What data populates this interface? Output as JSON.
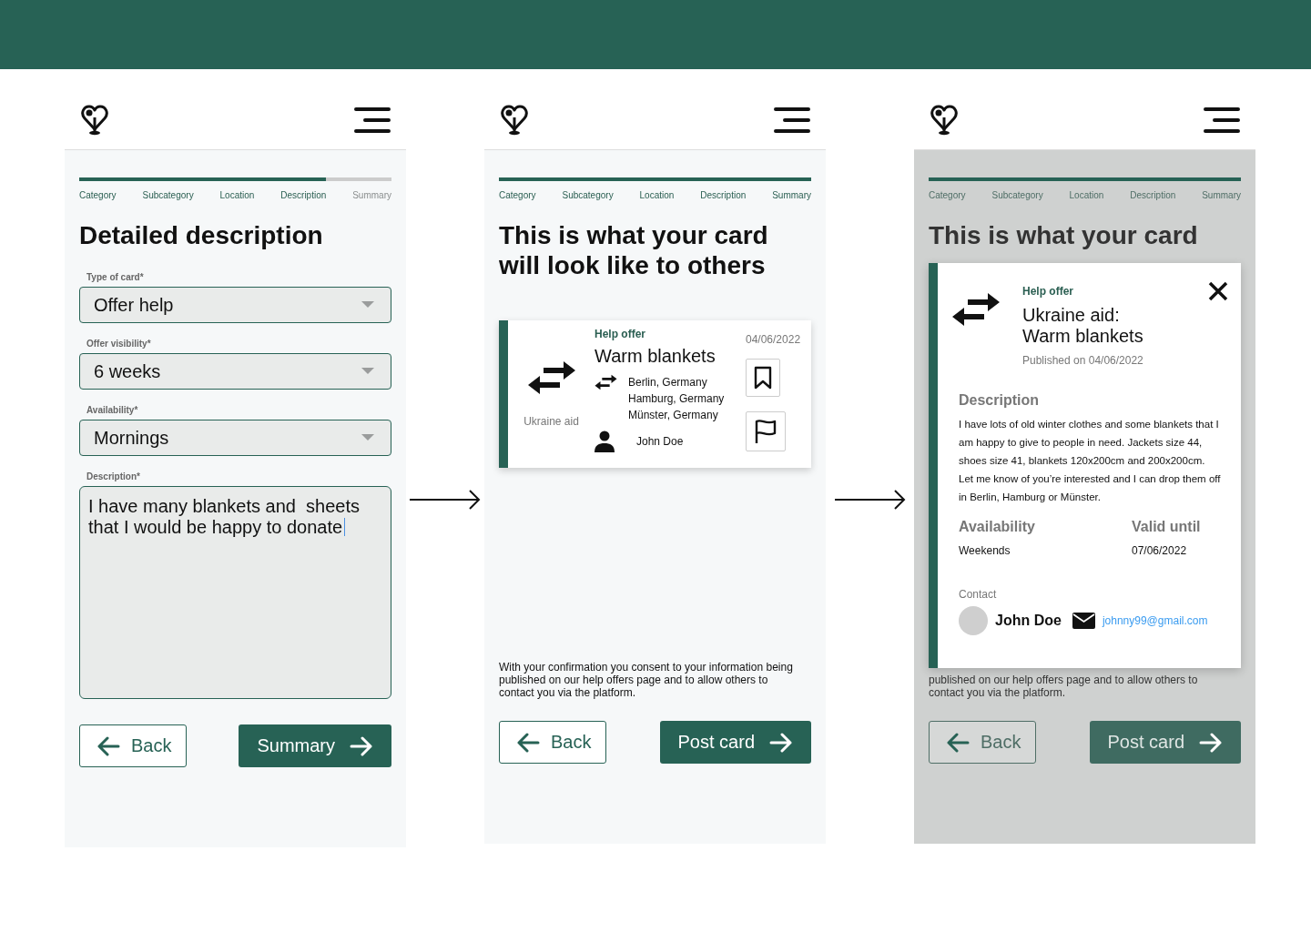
{
  "screens": [
    {
      "kind": "form",
      "progress": {
        "level": 0.79,
        "steps": [
          {
            "label": "Category",
            "reached": true
          },
          {
            "label": "Subcategory",
            "reached": true
          },
          {
            "label": "Location",
            "reached": true
          },
          {
            "label": "Description",
            "reached": true
          },
          {
            "label": "Summary",
            "reached": false
          }
        ]
      },
      "title": "Detailed description",
      "fields": [
        {
          "kind": "select",
          "label": "Type of card*",
          "value": "Offer help"
        },
        {
          "kind": "select",
          "label": "Offer visibility*",
          "value": "6 weeks"
        },
        {
          "kind": "select",
          "label": "Availability*",
          "value": "Mornings"
        },
        {
          "kind": "textarea",
          "label": "Description*",
          "value": "I have many blankets and  sheets that I would be happy to donate",
          "focused": true
        }
      ],
      "buttons": [
        {
          "kind": "back",
          "label": "Back"
        },
        {
          "kind": "next",
          "label": "Summary"
        }
      ]
    },
    {
      "kind": "preview",
      "dimmed": false,
      "progress": {
        "level": 1,
        "steps": [
          {
            "label": "Category",
            "reached": true
          },
          {
            "label": "Subcategory",
            "reached": true
          },
          {
            "label": "Location",
            "reached": true
          },
          {
            "label": "Description",
            "reached": true
          },
          {
            "label": "Summary",
            "reached": true
          }
        ]
      },
      "title": "This is what your card will look like to others",
      "card": {
        "category": "Ukraine aid",
        "type": "Help offer",
        "title": "Warm blankets",
        "date": "04/06/2022",
        "locations": [
          "Berlin, Germany",
          "Hamburg, Germany",
          "Münster, Germany"
        ],
        "author": "John Doe"
      },
      "consent": "With your confirmation you consent to your information being published on our help offers page and to allow others to contact you via the platform.",
      "buttons": [
        {
          "kind": "back",
          "label": "Back"
        },
        {
          "kind": "next",
          "label": "Post card"
        }
      ]
    },
    {
      "kind": "preview",
      "dimmed": true,
      "progress": {
        "level": 1,
        "steps": [
          {
            "label": "Category",
            "reached": true
          },
          {
            "label": "Subcategory",
            "reached": true
          },
          {
            "label": "Location",
            "reached": true
          },
          {
            "label": "Description",
            "reached": true
          },
          {
            "label": "Summary",
            "reached": true
          }
        ]
      },
      "title": "This is what your card",
      "consent": "published on our help offers page and to allow others to\ncontact you via the platform.",
      "buttons": [
        {
          "kind": "back",
          "label": "Back"
        },
        {
          "kind": "next",
          "label": "Post card"
        }
      ],
      "modal": {
        "type": "Help offer",
        "title": "Ukraine aid:\nWarm blankets",
        "published": "Published on 04/06/2022",
        "description_label": "Description",
        "description": [
          "I have lots of old winter clothes and some blankets that I am happy to give to people in need. Jackets size 44, shoes size 41, blankets 120x200cm and 200x200cm.",
          "Let me know of you’re interested and I can drop them off in Berlin, Hamburg or Münster."
        ],
        "details": [
          {
            "label": "Availability",
            "value": "Weekends"
          },
          {
            "label": "Valid until",
            "value": "07/06/2022"
          }
        ],
        "contact": {
          "label": "Contact",
          "name": "John Doe",
          "email": "johnny99@gmail.com"
        }
      }
    }
  ]
}
